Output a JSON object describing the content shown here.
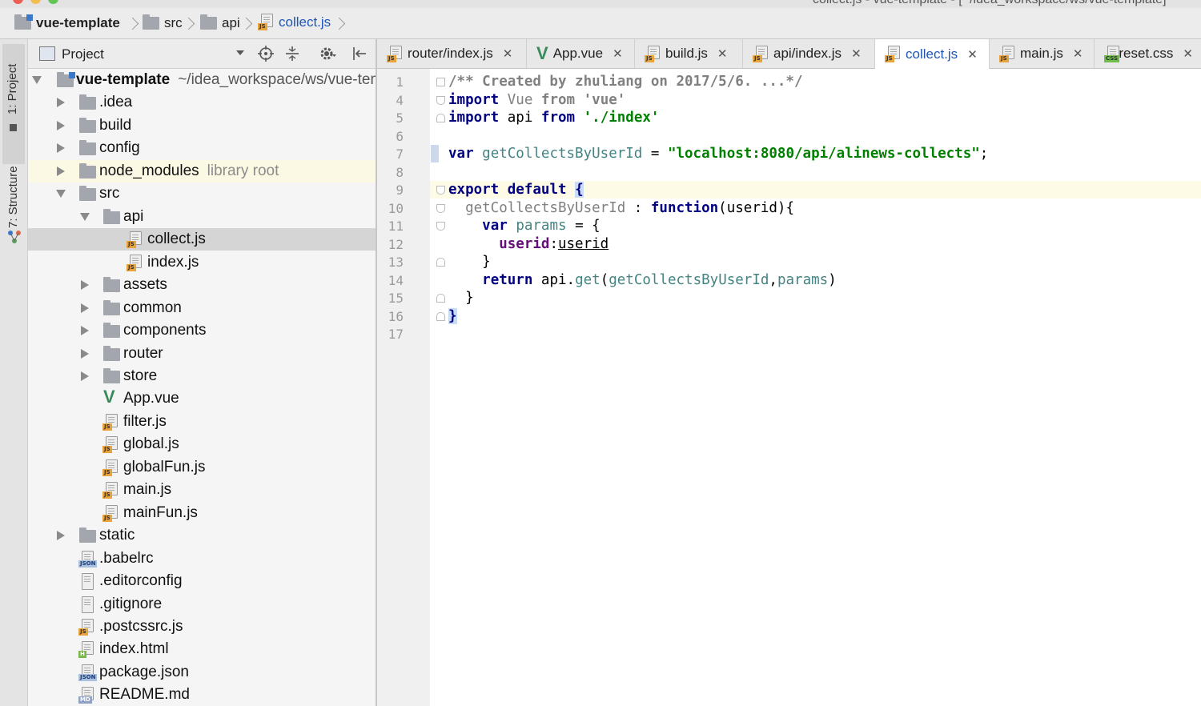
{
  "window": {
    "title": "collect.js - vue-template - [~/idea_workspace/ws/vue-template]"
  },
  "breadcrumb": {
    "items": [
      {
        "label": "vue-template",
        "icon": "project-folder-icon"
      },
      {
        "label": "src",
        "icon": "folder-icon"
      },
      {
        "label": "api",
        "icon": "folder-icon"
      },
      {
        "label": "collect.js",
        "icon": "js-file-icon"
      }
    ]
  },
  "tool_strip": {
    "project_tab": "1: Project",
    "structure_tab": "7: Structure"
  },
  "project_panel": {
    "title": "Project",
    "tree": [
      {
        "label": "vue-template",
        "hint": "~/idea_workspace/ws/vue-template",
        "icon": "project-folder-icon"
      },
      {
        "label": ".idea",
        "icon": "folder-icon"
      },
      {
        "label": "build",
        "icon": "folder-icon"
      },
      {
        "label": "config",
        "icon": "folder-icon"
      },
      {
        "label": "node_modules",
        "hint": "library root",
        "icon": "folder-icon"
      },
      {
        "label": "src",
        "icon": "folder-icon"
      },
      {
        "label": "api",
        "icon": "folder-icon"
      },
      {
        "label": "collect.js",
        "icon": "js-file-icon"
      },
      {
        "label": "index.js",
        "icon": "js-file-icon"
      },
      {
        "label": "assets",
        "icon": "folder-icon"
      },
      {
        "label": "common",
        "icon": "folder-icon"
      },
      {
        "label": "components",
        "icon": "folder-icon"
      },
      {
        "label": "router",
        "icon": "folder-icon"
      },
      {
        "label": "store",
        "icon": "folder-icon"
      },
      {
        "label": "App.vue",
        "icon": "vue-file-icon"
      },
      {
        "label": "filter.js",
        "icon": "js-file-icon"
      },
      {
        "label": "global.js",
        "icon": "js-file-icon"
      },
      {
        "label": "globalFun.js",
        "icon": "js-file-icon"
      },
      {
        "label": "main.js",
        "icon": "js-file-icon"
      },
      {
        "label": "mainFun.js",
        "icon": "js-file-icon"
      },
      {
        "label": "static",
        "icon": "folder-icon"
      },
      {
        "label": ".babelrc",
        "icon": "json-file-icon"
      },
      {
        "label": ".editorconfig",
        "icon": "text-file-icon"
      },
      {
        "label": ".gitignore",
        "icon": "text-file-icon"
      },
      {
        "label": ".postcssrc.js",
        "icon": "js-file-icon"
      },
      {
        "label": "index.html",
        "icon": "html-file-icon"
      },
      {
        "label": "package.json",
        "icon": "json-file-icon"
      },
      {
        "label": "README.md",
        "icon": "md-file-icon"
      }
    ]
  },
  "tabs": [
    {
      "label": "router/index.js",
      "icon": "js-file-icon"
    },
    {
      "label": "App.vue",
      "icon": "vue-file-icon"
    },
    {
      "label": "build.js",
      "icon": "js-file-icon"
    },
    {
      "label": "api/index.js",
      "icon": "js-file-icon"
    },
    {
      "label": "collect.js",
      "icon": "js-file-icon",
      "active": true
    },
    {
      "label": "main.js",
      "icon": "js-file-icon"
    },
    {
      "label": "reset.css",
      "icon": "css-file-icon"
    }
  ],
  "tag_labels": {
    "js": "JS",
    "json": "JSON",
    "css": "CSS",
    "html": "H",
    "md": "MD"
  },
  "tab_close_glyph": "✕",
  "editor": {
    "line_numbers": [
      "1",
      "4",
      "5",
      "6",
      "7",
      "8",
      "9",
      "10",
      "11",
      "12",
      "13",
      "14",
      "15",
      "16",
      "17"
    ],
    "code": {
      "l1_comment": "/** Created by zhuliang on 2017/5/6. ...*/",
      "l4_import": "import",
      "l4_ident": "Vue",
      "l4_from": "from",
      "l4_module": "'vue'",
      "l5_import": "import",
      "l5_ident": "api",
      "l5_from": "from",
      "l5_module": "'./index'",
      "l7_var": "var",
      "l7_name": "getCollectsByUserId",
      "l7_eq": " = ",
      "l7_value": "\"localhost:8080/api/alinews-collects\"",
      "l7_semi": ";",
      "l9_export": "export",
      "l9_default": "default",
      "l9_brace": "{",
      "l10_name": "getCollectsByUserId",
      "l10_colon": " : ",
      "l10_function": "function",
      "l10_params": "(userid){",
      "l11_var": "var",
      "l11_name": "params",
      "l11_rest": " = {",
      "l12_key": "userid",
      "l12_colon": ":",
      "l12_value": "userid",
      "l13_close": "}",
      "l14_return": "return",
      "l14_obj": "api.",
      "l14_get": "get",
      "l14_open": "(",
      "l14_arg1": "getCollectsByUserId",
      "l14_comma": ",",
      "l14_arg2": "params",
      "l14_close": ")",
      "l15_close": "}",
      "l16_close": "}"
    }
  }
}
